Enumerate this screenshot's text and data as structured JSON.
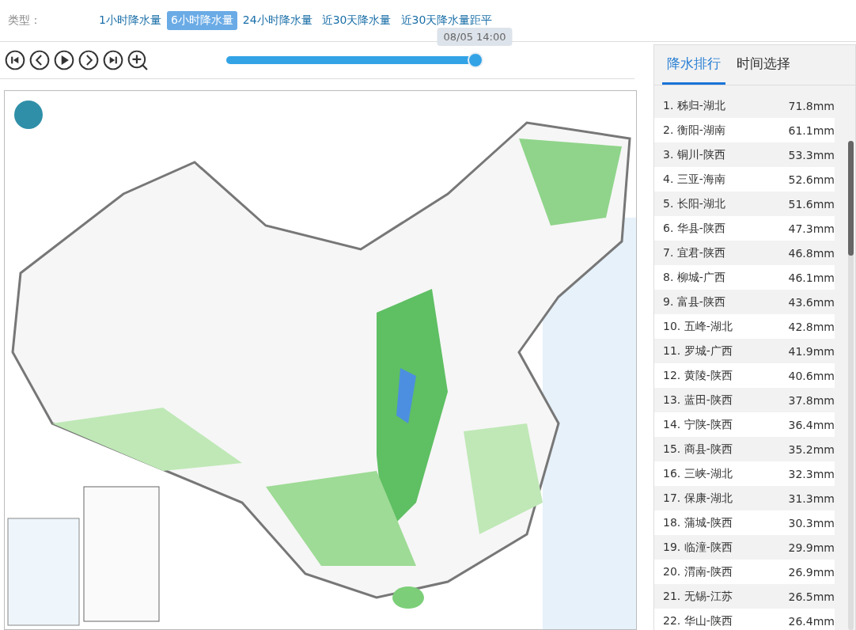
{
  "type_bar": {
    "label": "类型：",
    "options": [
      {
        "label": "1小时降水量",
        "selected": false
      },
      {
        "label": "6小时降水量",
        "selected": true
      },
      {
        "label": "24小时降水量",
        "selected": false
      },
      {
        "label": "近30天降水量",
        "selected": false
      },
      {
        "label": "近30天降水量距平",
        "selected": false
      }
    ]
  },
  "player": {
    "buttons": [
      {
        "kind": "first"
      },
      {
        "kind": "prev"
      },
      {
        "kind": "play"
      },
      {
        "kind": "next"
      },
      {
        "kind": "last"
      },
      {
        "kind": "zoom"
      }
    ],
    "timeline": {
      "level": 1.0,
      "tooltip": "08/05 14:00"
    }
  },
  "panel": {
    "tabs": [
      {
        "label": "降水排行",
        "selected": true
      },
      {
        "label": "时间选择",
        "selected": false
      }
    ],
    "ranking": [
      {
        "name": "1. 秭归-湖北",
        "value": "71.8mm"
      },
      {
        "name": "2. 衡阳-湖南",
        "value": "61.1mm"
      },
      {
        "name": "3. 铜川-陕西",
        "value": "53.3mm"
      },
      {
        "name": "4. 三亚-海南",
        "value": "52.6mm"
      },
      {
        "name": "5. 长阳-湖北",
        "value": "51.6mm"
      },
      {
        "name": "6. 华县-陕西",
        "value": "47.3mm"
      },
      {
        "name": "7. 宜君-陕西",
        "value": "46.8mm"
      },
      {
        "name": "8. 柳城-广西",
        "value": "46.1mm"
      },
      {
        "name": "9. 富县-陕西",
        "value": "43.6mm"
      },
      {
        "name": "10. 五峰-湖北",
        "value": "42.8mm"
      },
      {
        "name": "11. 罗城-广西",
        "value": "41.9mm"
      },
      {
        "name": "12. 黄陵-陕西",
        "value": "40.6mm"
      },
      {
        "name": "13. 蓝田-陕西",
        "value": "37.8mm"
      },
      {
        "name": "14. 宁陕-陕西",
        "value": "36.4mm"
      },
      {
        "name": "15. 商县-陕西",
        "value": "35.2mm"
      },
      {
        "name": "16. 三峡-湖北",
        "value": "32.3mm"
      },
      {
        "name": "17. 保康-湖北",
        "value": "31.3mm"
      },
      {
        "name": "18. 蒲城-陕西",
        "value": "30.3mm"
      },
      {
        "name": "19. 临潼-陕西",
        "value": "29.9mm"
      },
      {
        "name": "20. 渭南-陕西",
        "value": "26.9mm"
      },
      {
        "name": "21. 无锡-江苏",
        "value": "26.5mm"
      },
      {
        "name": "22. 华山-陕西",
        "value": "26.4mm"
      }
    ]
  }
}
